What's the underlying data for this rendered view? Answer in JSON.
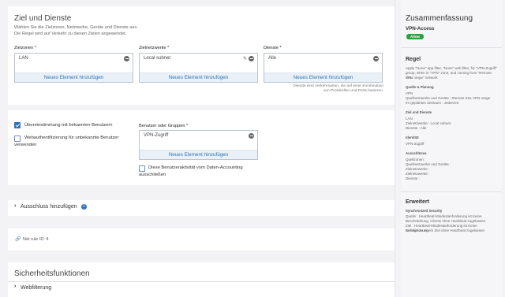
{
  "section": {
    "title": "Ziel und Dienste",
    "subtitle_line1": "Wählen Sie die Zielzonen, Netzwerke, Geräte und Dienste aus.",
    "subtitle_line2": "Die Regel wird auf Verkehr zu diesen Zielen angewendet."
  },
  "fields": {
    "zones": {
      "label": "Zielzonen *",
      "value": "LAN",
      "add_label": "Neues Element hinzufügen"
    },
    "networks": {
      "label": "Zielnetzwerke *",
      "value": "Local subnet",
      "add_label": "Neues Element hinzufügen"
    },
    "services": {
      "label": "Dienste *",
      "value": "Alle",
      "add_label": "Neues Element hinzufügen",
      "hint_line1": "Dienste sind Verkehrsarten, die auf einer Kombination",
      "hint_line2": "von Protokollen und Ports basieren."
    }
  },
  "users": {
    "match_known_label": "Übereinstimmung mit bekannten Benutzern",
    "match_known_checked": true,
    "webauth_label_line1": "Webauthentifizierung für unbekannte Benutzer",
    "webauth_label_line2": "verwenden",
    "webauth_checked": false,
    "group_label": "Benutzer oder Gruppen *",
    "group_value": "VPN-Zugriff",
    "group_add_label": "Neues Element hinzufügen",
    "accounting_label_line1": "Diese Benutzeraktivität vom Daten-Accounting",
    "accounting_label_line2": "ausschließen",
    "accounting_checked": false
  },
  "exclusion": {
    "label": "Ausschluss hinzufügen"
  },
  "net_rule": {
    "label": "Net rule ID: 4"
  },
  "security": {
    "title": "Sicherheitsfunktionen",
    "webfilter_label": "Webfilterung"
  },
  "summary": {
    "title": "Zusammenfassung",
    "policy_name": "VPN-Access",
    "action_badge": "Allow",
    "rule_heading": "Regel",
    "rule_text_1": "Apply \"None\" app filter, \"None\" web filter, for \"VPN-Zugriff\"",
    "rule_text_2": "group, when in \"VPN\" zone, and coming from \"Remote SSL",
    "rule_text_3": "VPN range\" network",
    "source_heading": "Quelle & Planung",
    "source_1": "VPN",
    "source_2": "Quellnetzwerke und Geräte : Remote SSL VPN range",
    "source_3": "Im geplanten Zeitraum : Jederzeit",
    "dest_heading": "Ziel und Dienste",
    "dest_1": "LAN",
    "dest_2": "Zielnetzwerke : Local subnet",
    "dest_3": "Dienste : Alle",
    "identity_heading": "Identität",
    "identity_1": "VPN-Zugriff",
    "excl_heading": "Ausschlüsse",
    "excl_1": "Quellzonen :",
    "excl_2": "Quellnetzwerke und Geräte :",
    "excl_3": "Zielnetzwerke :",
    "excl_4": "Zielnetzwerke :",
    "excl_5": "Dienste :",
    "advanced_heading": "Erweitert",
    "sync_heading": "Synchronized Security",
    "sync_1": "Quelle : Heartbeat-Mindestanforderung ist Keine",
    "sync_2": "Beschränkung, Clients ohne Heartbeat zugelassen",
    "sync_3": "Ziel : Heartbeat-Mindestanforderung ist Keine Beschränkung",
    "sync_4": "Anfrage zu einem Ziel ohne Heartbeat zugelassen"
  },
  "colors": {
    "accent": "#2d74b8",
    "allow": "#2ea043"
  }
}
